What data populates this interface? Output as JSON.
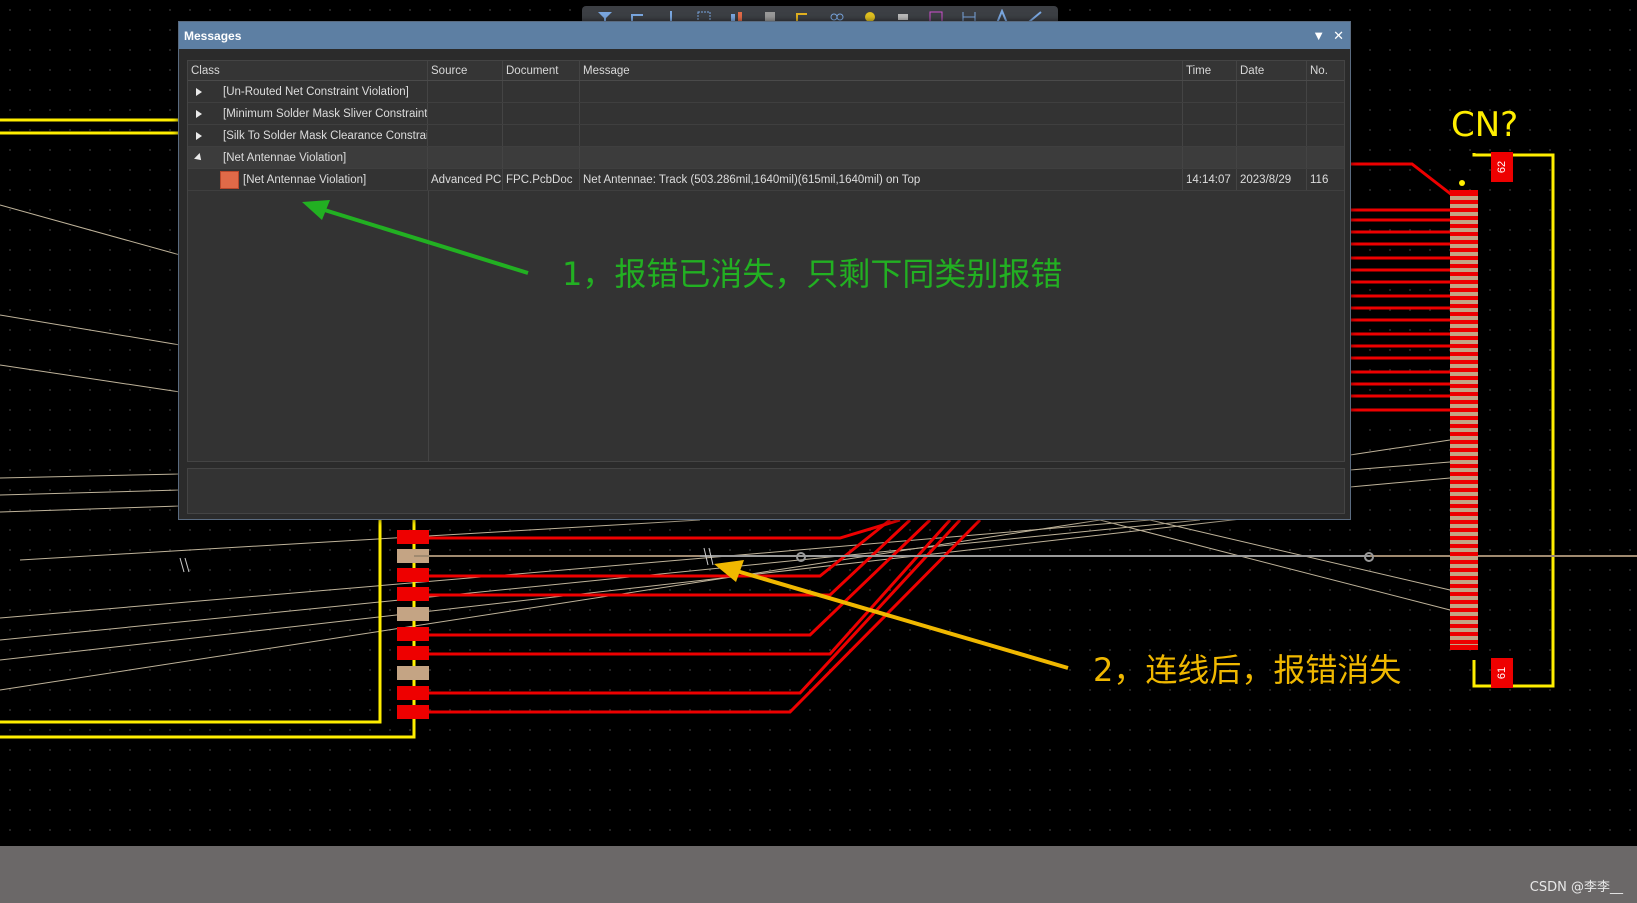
{
  "panel": {
    "title": "Messages",
    "columns": {
      "class": "Class",
      "source": "Source",
      "document": "Document",
      "message": "Message",
      "time": "Time",
      "date": "Date",
      "no": "No."
    },
    "groups": [
      {
        "label": "[Un-Routed Net Constraint Violation]",
        "expanded": false
      },
      {
        "label": "[Minimum Solder Mask Sliver Constraint",
        "expanded": false
      },
      {
        "label": "[Silk To Solder Mask Clearance Constraint",
        "expanded": false
      },
      {
        "label": "[Net Antennae Violation]",
        "expanded": true
      }
    ],
    "entry": {
      "class": "[Net Antennae Violation]",
      "source": "Advanced PCB",
      "document": "FPC.PcbDoc",
      "message": "Net Antennae: Track (503.286mil,1640mil)(615mil,1640mil) on Top",
      "time": "14:14:07",
      "date": "2023/8/29",
      "no": "116"
    }
  },
  "annotations": {
    "first": "1，报错已消失，只剩下同类别报错",
    "second": "2，连线后，报错消失"
  },
  "pcb": {
    "designator": "CN?",
    "pin_top": "62",
    "pin_bottom": "61"
  },
  "toolbar_icons": [
    "filter-icon",
    "route-icon",
    "place-track-icon",
    "select-rectangle-icon",
    "align-icon",
    "component-icon",
    "interactive-route-icon",
    "diff-pair-icon",
    "via-icon",
    "pad-icon",
    "region-icon",
    "dimension-icon",
    "text-icon",
    "line-icon"
  ],
  "colors": {
    "panel_title": "#5d7fa3",
    "annotation_green": "#22b022",
    "annotation_yellow": "#f0b800",
    "track_red": "#ee0000",
    "outline_yellow": "#ffee00"
  },
  "watermark": "CSDN @李李__"
}
